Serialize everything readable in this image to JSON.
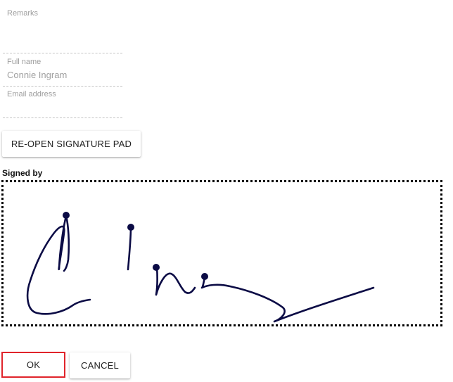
{
  "form": {
    "remarks": {
      "label": "Remarks",
      "value": ""
    },
    "full_name": {
      "label": "Full name",
      "value": "Connie Ingram"
    },
    "email": {
      "label": "Email address",
      "value": ""
    }
  },
  "buttons": {
    "reopen_label": "RE-OPEN SIGNATURE PAD",
    "ok_label": "OK",
    "cancel_label": "CANCEL"
  },
  "signature": {
    "label": "Signed by",
    "ink_color": "#0b0b45"
  },
  "colors": {
    "focus_outline": "#e0242b"
  }
}
